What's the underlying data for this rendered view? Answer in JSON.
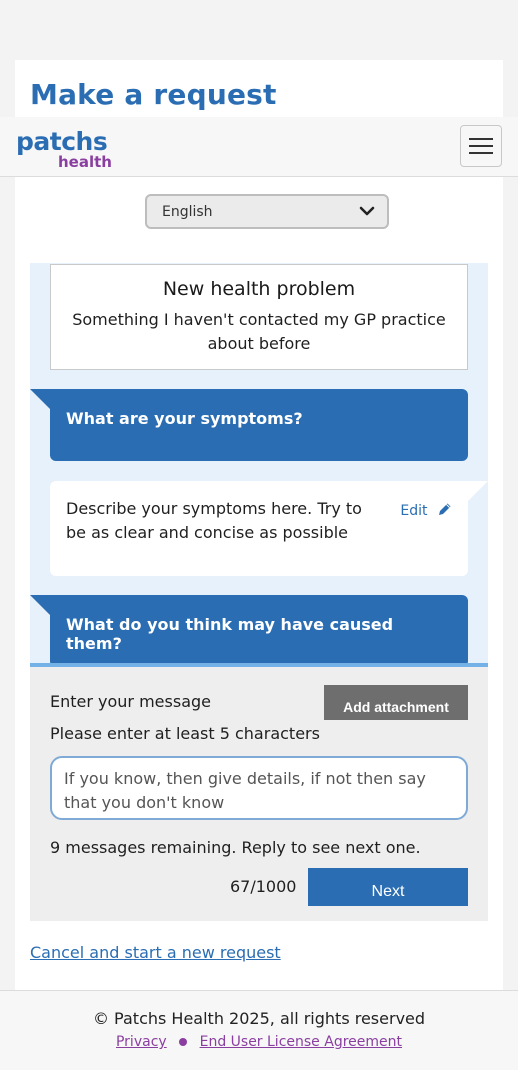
{
  "page": {
    "title": "Make a request"
  },
  "brand": {
    "logo_top": "patchs",
    "logo_bottom": "health",
    "primary_color": "#2a6db3",
    "accent_color": "#8a3fa0"
  },
  "language": {
    "selected": "English",
    "icon": "chevron-down-icon"
  },
  "request_type": {
    "title": "New health problem",
    "subtitle": "Something I haven't contacted my GP practice about before"
  },
  "conversation": {
    "q1": "What are your symptoms?",
    "a1": "Describe your symptoms here. Try to be as clear and concise as possible",
    "edit_label": "Edit",
    "q2": "What do you think may have caused them?"
  },
  "compose": {
    "label": "Enter your message",
    "attach_label": "Add attachment",
    "hint": "Please enter at least 5 characters",
    "value": "If you know, then give details, if not then say that you don't know",
    "remaining": "9 messages remaining. Reply to see next one.",
    "counter": "67/1000",
    "next_label": "Next"
  },
  "cancel_link": "Cancel and start a new request",
  "footer": {
    "copyright": "© Patchs Health 2025, all rights reserved",
    "privacy": "Privacy",
    "eula": "End User License Agreement"
  }
}
